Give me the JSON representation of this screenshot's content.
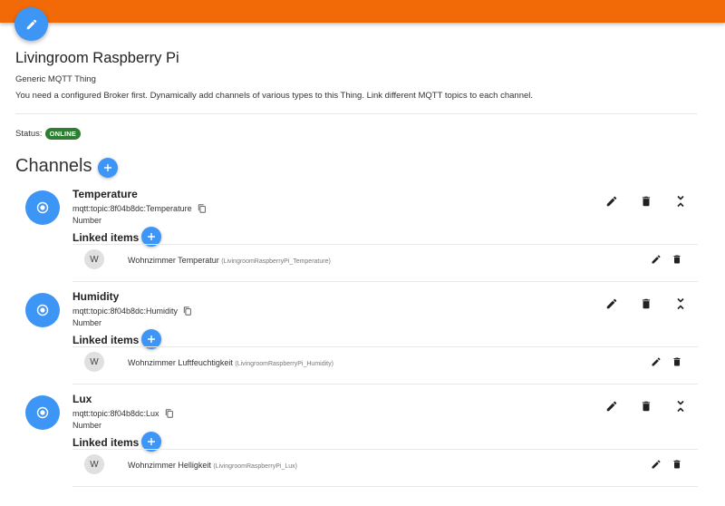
{
  "thing": {
    "title": "Livingroom Raspberry Pi",
    "type_label": "Generic MQTT Thing",
    "description": "You need a configured Broker first. Dynamically add channels of various types to this Thing. Link different MQTT topics to each channel.",
    "status_label": "Status:",
    "status_value": "ONLINE"
  },
  "channels_section": {
    "heading": "Channels"
  },
  "channels": [
    {
      "name": "Temperature",
      "uid": "mqtt:topic:8f04b8dc:Temperature",
      "type": "Number",
      "linked_label": "Linked items",
      "item": {
        "avatar": "W",
        "label": "Wohnzimmer Temperatur",
        "name": "(LivingroomRaspberryPi_Temperature)"
      }
    },
    {
      "name": "Humidity",
      "uid": "mqtt:topic:8f04b8dc:Humidity",
      "type": "Number",
      "linked_label": "Linked items",
      "item": {
        "avatar": "W",
        "label": "Wohnzimmer Luftfeuchtigkeit",
        "name": "(LivingroomRaspberryPi_Humidity)"
      }
    },
    {
      "name": "Lux",
      "uid": "mqtt:topic:8f04b8dc:Lux",
      "type": "Number",
      "linked_label": "Linked items",
      "item": {
        "avatar": "W",
        "label": "Wohnzimmer Helligkeit",
        "name": "(LivingroomRaspberryPi_Lux)"
      }
    }
  ],
  "colors": {
    "toolbar": "#f26a07",
    "accent": "#3d95f5",
    "online": "#2e7d32"
  },
  "icons": {
    "edit_fab": "pencil-icon",
    "add": "plus-icon",
    "channel": "radio-button-icon",
    "copy": "copy-icon",
    "edit": "pencil-icon",
    "delete": "trash-icon",
    "collapse": "collapse-icon"
  }
}
